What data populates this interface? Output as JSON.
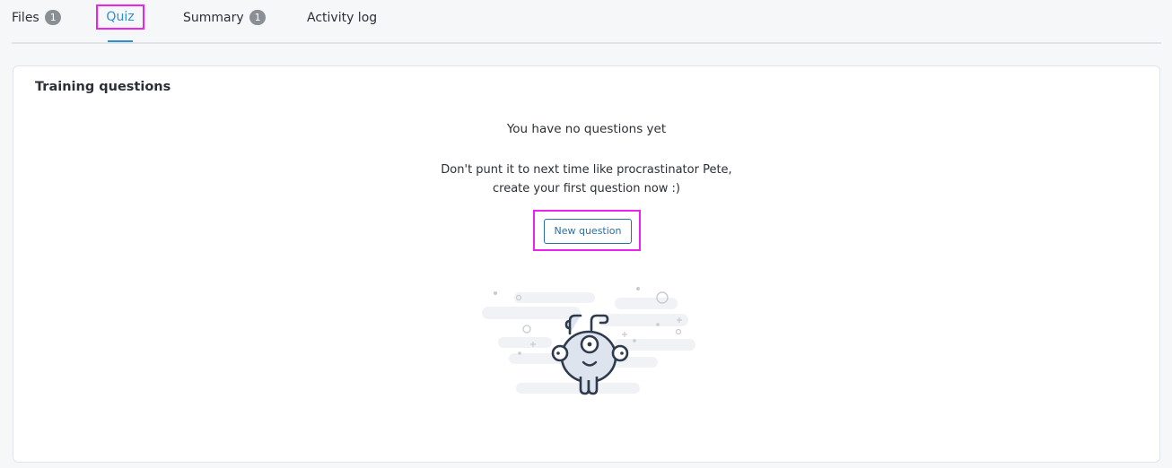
{
  "tabs": {
    "files": {
      "label": "Files",
      "badge": "1"
    },
    "quiz": {
      "label": "Quiz"
    },
    "summary": {
      "label": "Summary",
      "badge": "1"
    },
    "activity": {
      "label": "Activity log"
    }
  },
  "colors": {
    "accent": "#2e8fd0",
    "highlight": "#ee22ee",
    "button_border": "#2a6fa1",
    "badge": "#8a8f96"
  },
  "card": {
    "title": "Training questions",
    "empty_title": "You have no questions yet",
    "empty_desc_line1": "Don't punt it to next time like procrastinator Pete,",
    "empty_desc_line2": "create your first question now :)",
    "new_question_label": "New question",
    "illustration_icon": "monster-illustration"
  }
}
